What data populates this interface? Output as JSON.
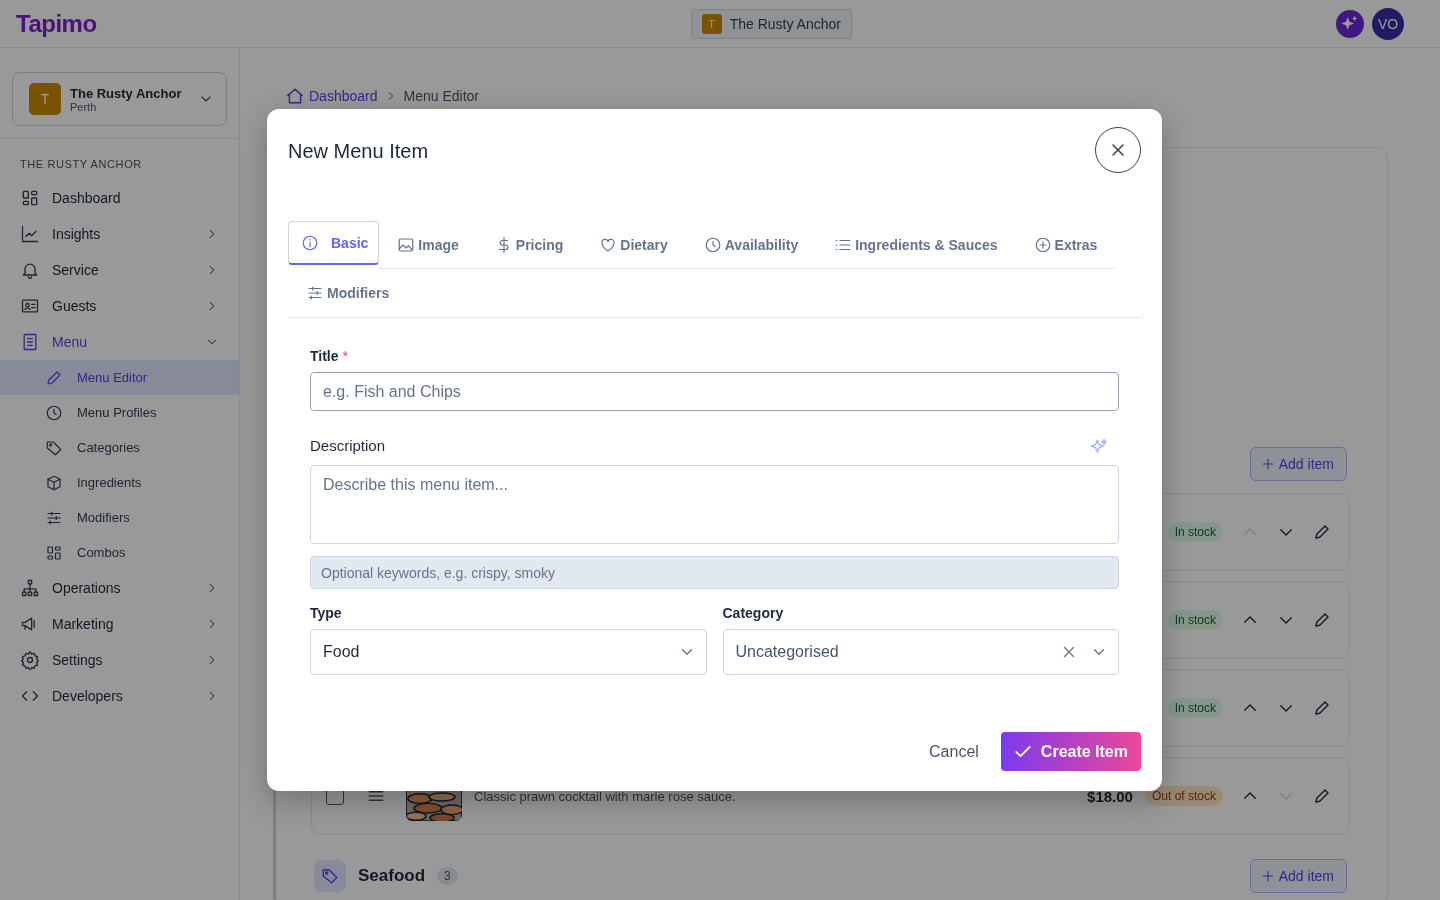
{
  "header": {
    "logo": "Tapimo",
    "venue_initial": "T",
    "venue_name": "The Rusty Anchor",
    "user_initials": "VO"
  },
  "sidebar": {
    "venue": {
      "initial": "T",
      "name": "The Rusty Anchor",
      "city": "Perth"
    },
    "section": "THE RUSTY ANCHOR",
    "items": [
      {
        "label": "Dashboard"
      },
      {
        "label": "Insights",
        "expanded": false
      },
      {
        "label": "Service",
        "expanded": false
      },
      {
        "label": "Guests",
        "expanded": false
      },
      {
        "label": "Menu",
        "expanded": true,
        "children": [
          {
            "label": "Menu Editor",
            "selected": true
          },
          {
            "label": "Menu Profiles",
            "selected": false
          },
          {
            "label": "Categories",
            "selected": false
          },
          {
            "label": "Ingredients",
            "selected": false
          },
          {
            "label": "Modifiers",
            "selected": false
          },
          {
            "label": "Combos",
            "selected": false
          }
        ]
      },
      {
        "label": "Operations",
        "expanded": false
      },
      {
        "label": "Marketing",
        "expanded": false
      },
      {
        "label": "Settings",
        "expanded": false
      },
      {
        "label": "Developers",
        "expanded": false
      }
    ]
  },
  "breadcrumb": [
    "Dashboard",
    "Menu Editor"
  ],
  "menu_list": {
    "add_item": "Add item",
    "rows": [
      {
        "badge": "In stock",
        "in_stock": true,
        "up_disabled": true,
        "down_disabled": false
      },
      {
        "badge": "In stock",
        "in_stock": true,
        "up_disabled": false,
        "down_disabled": false
      },
      {
        "badge": "In stock",
        "in_stock": true,
        "up_disabled": false,
        "down_disabled": false
      },
      {
        "checked": false,
        "description": "Classic prawn cocktail with marie rose sauce.",
        "price": "$18.00",
        "badge": "Out of stock",
        "in_stock": false,
        "up_disabled": false,
        "down_disabled": true
      }
    ],
    "next_category": {
      "name": "Seafood",
      "count": "3",
      "add_item": "Add item"
    }
  },
  "modal": {
    "title": "New Menu Item",
    "tabs": [
      {
        "label": "Basic",
        "selected": true
      },
      {
        "label": "Image",
        "selected": false
      },
      {
        "label": "Pricing",
        "selected": false
      },
      {
        "label": "Dietary",
        "selected": false
      },
      {
        "label": "Availability",
        "selected": false
      },
      {
        "label": "Ingredients & Sauces",
        "selected": false
      },
      {
        "label": "Extras",
        "selected": false
      },
      {
        "label": "Modifiers",
        "selected": false
      }
    ],
    "title_label": "Title",
    "required_mark": "*",
    "title_placeholder": "e.g. Fish and Chips",
    "description_label": "Description",
    "description_placeholder": "Describe this menu item...",
    "keywords_placeholder": "Optional keywords, e.g. crispy, smoky",
    "type_label": "Type",
    "type_value": "Food",
    "category_label": "Category",
    "category_value": "Uncategorised",
    "cancel": "Cancel",
    "create": "Create Item"
  }
}
